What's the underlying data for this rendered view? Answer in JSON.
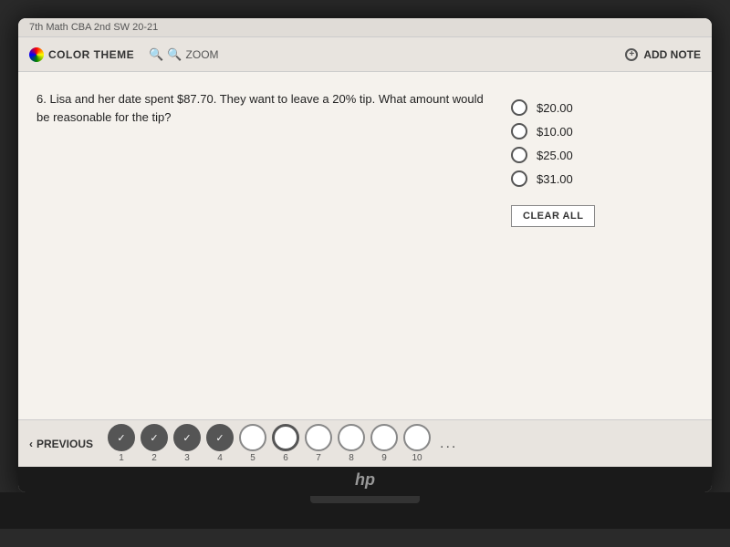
{
  "header": {
    "title": "7th Math CBA 2nd SW 20-21",
    "color_theme_label": "COLOR THEME",
    "zoom_label": "ZOOM",
    "add_note_label": "ADD NOTE"
  },
  "question": {
    "number": "6",
    "text": "Lisa and her date spent $87.70. They want to leave a 20% tip. What amount would be reasonable for the tip?"
  },
  "answers": [
    {
      "id": "a",
      "value": "$20.00"
    },
    {
      "id": "b",
      "value": "$10.00"
    },
    {
      "id": "c",
      "value": "$25.00"
    },
    {
      "id": "d",
      "value": "$31.00"
    }
  ],
  "clear_all_label": "CLEAR ALL",
  "navigation": {
    "prev_label": "PREVIOUS",
    "items": [
      {
        "number": "1",
        "state": "answered"
      },
      {
        "number": "2",
        "state": "answered"
      },
      {
        "number": "3",
        "state": "answered"
      },
      {
        "number": "4",
        "state": "answered"
      },
      {
        "number": "5",
        "state": "unanswered"
      },
      {
        "number": "6",
        "state": "current"
      },
      {
        "number": "7",
        "state": "unanswered"
      },
      {
        "number": "8",
        "state": "unanswered"
      },
      {
        "number": "9",
        "state": "unanswered"
      },
      {
        "number": "10",
        "state": "unanswered"
      }
    ],
    "more_label": "..."
  }
}
